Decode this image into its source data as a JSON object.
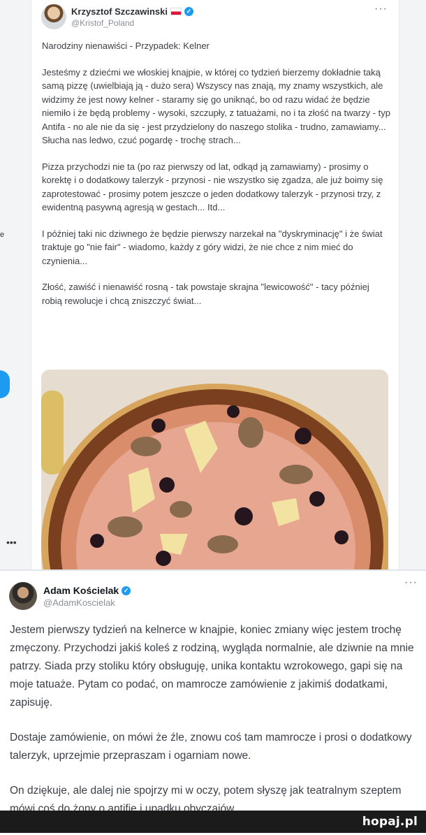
{
  "tweet1": {
    "author_name": "Krzysztof Szczawinski",
    "handle": "@Kristof_Poland",
    "more_icon": "more-horizontal-icon",
    "paragraphs": [
      "Narodziny nienawiści - Przypadek: Kelner",
      "Jesteśmy z dziećmi we włoskiej knajpie, w której co tydzień bierzemy dokładnie taką samą pizzę (uwielbiają ją - dużo sera) Wszyscy nas znają, my znamy wszystkich, ale widzimy że jest nowy kelner - staramy się go uniknąć, bo od razu widać że będzie niemiło i że będą problemy - wysoki, szczupły, z tatuażami, no i ta złość na twarzy - typ Antifa - no ale nie da się - jest przydzielony do naszego stolika - trudno, zamawiamy... Słucha nas ledwo, czuć pogardę - trochę strach...",
      "Pizza przychodzi nie ta (po raz pierwszy od lat, odkąd ją zamawiamy) - prosimy o korektę i o dodatkowy talerzyk - przynosi - nie wszystko się zgadza, ale już boimy się zaprotestować - prosimy potem jeszcze o jeden dodatkowy talerzyk - przynosi trzy, z ewidentną pasywną agresją w gestach... Itd...",
      "I później taki nic dziwnego że będzie pierwszy narzekał na \"dyskryminację\" i że świat traktuje go \"nie fair\" - wiadomo, każdy z góry widzi, że nie chce z nim mieć do czynienia...",
      "Złość, zawiść i nienawiść rosną - tak powstaje skrajna \"lewicowość\" - tacy później robią rewolucje i chcą zniszczyć świat..."
    ]
  },
  "tweet2": {
    "author_name": "Adam Kościelak",
    "handle": "@AdamKoscielak",
    "paragraphs": [
      "Jestem pierwszy tydzień na kelnerce w knajpie, koniec zmiany więc jestem trochę zmęczony. Przychodzi jakiś koleś z rodziną, wygląda normalnie, ale dziwnie na mnie patrzy. Siada przy stoliku który obsługuję, unika kontaktu wzrokowego, gapi się na moje tatuaże. Pytam co podać, on mamrocze zamówienie z jakimiś dodatkami, zapisuję.",
      "Dostaje zamówienie, on mówi że źle, znowu coś tam mamrocze i prosi o dodatkowy talerzyk, uprzejmie przepraszam i ogarniam nowe.",
      "On dziękuje, ale dalej nie spojrzy mi w oczy, potem słyszę jak teatralnym szeptem mówi coś do żony o antifie i upadku obyczajów."
    ]
  },
  "footer": {
    "logo": "hopaj.pl"
  },
  "colors": {
    "verified": "#1d9bf0",
    "footer_bg": "#1b1b1b"
  }
}
